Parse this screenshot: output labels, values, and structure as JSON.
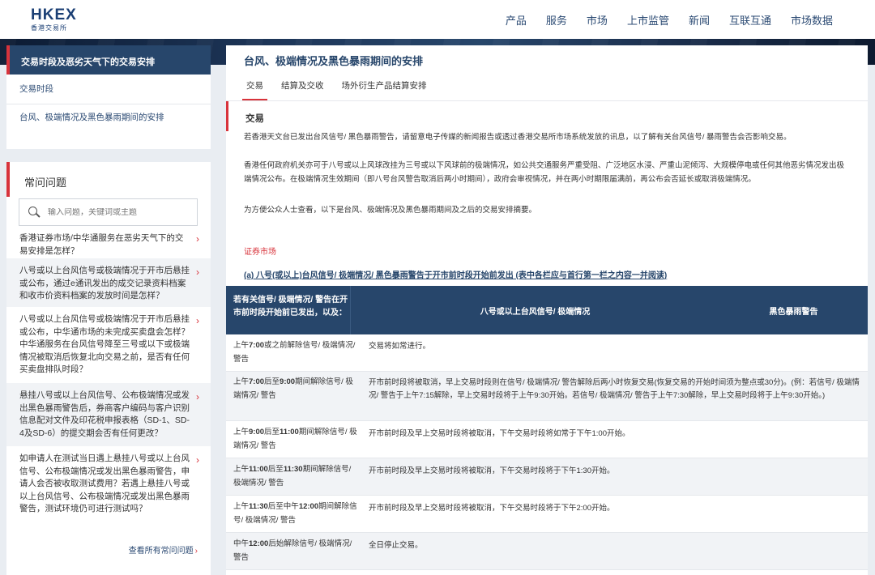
{
  "header": {
    "logo_main": "HKEX",
    "logo_sub": "香港交易所",
    "nav": [
      "产品",
      "服务",
      "市场",
      "上市监管",
      "新闻",
      "互联互通",
      "市场数据"
    ]
  },
  "leftnav": {
    "header": "交易时段及恶劣天气下的交易安排",
    "items": [
      "交易时段",
      "台风、极端情况及黑色暴雨期间的安排"
    ]
  },
  "faq": {
    "title": "常问问题",
    "search_placeholder": "输入问题，关键词或主题",
    "items": [
      "香港证券市场/中华通服务在恶劣天气下的交易安排是怎样？",
      "八号或以上台风信号或极端情况于开市后悬挂或公布，通过e通讯发出的成交记录资料档案和收市价资料档案的发放时间是怎样？",
      "八号或以上台风信号或极端情况于开市后悬挂或公布，中华通市场的未完成买卖盘会怎样？中华通服务在台风信号降至三号或以下或极端情况被取消后恢复北向交易之前，是否有任何买卖盘排队时段？",
      "悬挂八号或以上台风信号、公布极端情况或发出黑色暴雨警告后，券商客户编码与客户识别信息配对文件及印花税申报表格（SD-1、SD-4及SD-6）的提交期会否有任何更改？",
      "如申请人在测试当日遇上悬挂八号或以上台风信号、公布极端情况或发出黑色暴雨警告，申请人会否被收取测试费用？若遇上悬挂八号或以上台风信号、公布极端情况或发出黑色暴雨警告，测试环境仍可进行测试吗？"
    ],
    "view_all": "查看所有常问问题"
  },
  "main": {
    "title": "台风、极端情况及黑色暴雨期间的安排",
    "tabs": [
      "交易",
      "结算及交收",
      "场外衍生产品结算安排"
    ],
    "section_title": "交易",
    "paragraphs": [
      "若香港天文台已发出台风信号/ 黑色暴雨警告，请留意电子传媒的新闻报告或透过香港交易所市场系统发放的讯息，以了解有关台风信号/ 暴雨警告会否影响交易。",
      "香港任何政府机关亦可于八号或以上风球改挂为三号或以下风球前的极端情况，如公共交通服务严重受阻、广泛地区水浸、严重山泥倾泻、大规模停电或任何其他恶劣情况发出极端情况公布。在极端情况生效期间（即八号台风警告取消后两小时期间），政府会审视情况，并在两小时期限届满前，再公布会否延长或取消极端情况。",
      "为方便公众人士查看，以下是台风、极端情况及黑色暴雨期间及之后的交易安排摘要。"
    ],
    "subheading": "证券市场",
    "table_caption": "(a) 八号(或以上)台风信号/ 极端情况/ 黑色暴雨警告于开市前时段开始前发出 (表中各栏应与首行第一栏之内容一并阅读)",
    "table": {
      "headers": [
        "若有关信号/ 极端情况/ 警告在开市前时段开始前已发出，以及：",
        "八号或以上台风信号/ 极端情况",
        "黑色暴雨警告"
      ],
      "rows": [
        {
          "pre": "上午",
          "time": "7:00",
          "suffix": "或之前解除信号/ 极端情况/ 警告",
          "text": "交易将如常进行。"
        },
        {
          "pre": "上午",
          "time": "7:00",
          "mid": "后至",
          "time2": "9:00",
          "suffix": "期间解除信号/ 极端情况/ 警告",
          "text": "开市前时段将被取消，早上交易时段则在信号/ 极端情况/ 警告解除后两小时恢复交易(恢复交易的开始时间须为整点或30分)。(例：若信号/ 极端情况/ 警告于上午7:15解除，早上交易时段将于上午9:30开始。若信号/ 极端情况/ 警告于上午7:30解除，早上交易时段将于上午9:30开始。)"
        },
        {
          "pre": "上午",
          "time": "9:00",
          "mid": "后至",
          "time2": "11:00",
          "suffix": "期间解除信号/ 极端情况/ 警告",
          "text": "开市前时段及早上交易时段将被取消，下午交易时段将如常于下午1:00开始。"
        },
        {
          "pre": "上午",
          "time": "11:00",
          "mid": "后至",
          "time2": "11:30",
          "suffix": "期间解除信号/ 极端情况/ 警告",
          "text": "开市前时段及早上交易时段将被取消，下午交易时段将于下午1:30开始。"
        },
        {
          "pre": "上午",
          "time": "11:30",
          "mid": "后至中午",
          "time2": "12:00",
          "suffix": "期间解除信号/ 极端情况/ 警告",
          "text": "开市前时段及早上交易时段将被取消，下午交易时段将于下午2:00开始。"
        },
        {
          "pre": "中午",
          "time": "12:00",
          "suffix": "后始解除信号/ 极端情况/ 警告",
          "text": "全日停止交易。"
        }
      ]
    }
  }
}
